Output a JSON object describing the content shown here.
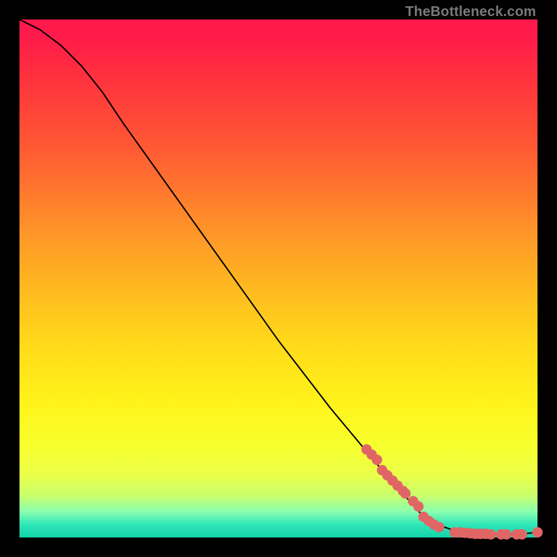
{
  "watermark": "TheBottleneck.com",
  "chart_data": {
    "type": "line",
    "title": "",
    "xlabel": "",
    "ylabel": "",
    "xlim": [
      0,
      100
    ],
    "ylim": [
      0,
      100
    ],
    "grid": false,
    "legend": false,
    "series": [
      {
        "name": "curve",
        "x": [
          0,
          4,
          8,
          12,
          16,
          20,
          30,
          40,
          50,
          60,
          70,
          78,
          82,
          85,
          88,
          92,
          96,
          100
        ],
        "y": [
          100,
          98,
          95,
          91,
          86,
          80,
          66,
          52,
          38,
          25,
          13,
          4,
          2,
          1,
          0.7,
          0.6,
          0.6,
          1
        ]
      }
    ],
    "highlight_points": {
      "name": "dots",
      "x": [
        67,
        68,
        69,
        70,
        71,
        72,
        73,
        74,
        74.5,
        76,
        77,
        78,
        79,
        80,
        81,
        84,
        85,
        86,
        87,
        88,
        89,
        90,
        91,
        93,
        94,
        96,
        97,
        100
      ],
      "y": [
        17,
        16,
        15,
        13,
        12,
        11,
        10,
        9,
        8.5,
        7,
        6,
        4,
        3.2,
        2.5,
        2,
        1,
        1,
        0.9,
        0.8,
        0.7,
        0.7,
        0.7,
        0.6,
        0.6,
        0.6,
        0.6,
        0.6,
        1
      ]
    },
    "colors": {
      "line": "#000000",
      "dots": "#e06666",
      "gradient_top": "#ff1a4b",
      "gradient_mid": "#fff31a",
      "gradient_bottom": "#13d2a9"
    }
  }
}
